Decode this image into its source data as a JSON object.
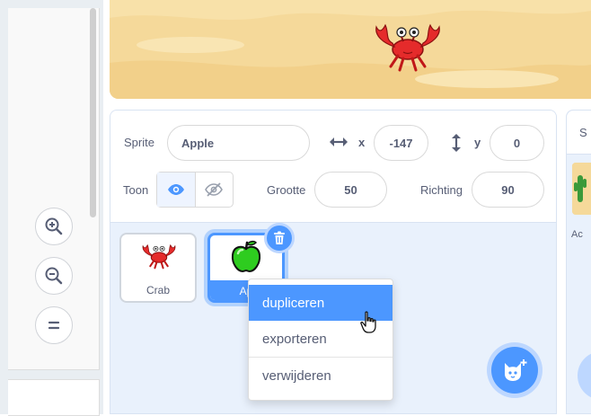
{
  "sprite_info": {
    "sprite_label": "Sprite",
    "sprite_name": "Apple",
    "x_label": "x",
    "x_value": "-147",
    "y_label": "y",
    "y_value": "0",
    "show_label": "Toon",
    "size_label": "Grootte",
    "size_value": "50",
    "direction_label": "Richting",
    "direction_value": "90"
  },
  "sprites": [
    {
      "name": "Crab",
      "selected": false
    },
    {
      "name": "Apple",
      "selected": true,
      "visible_label": "Ap"
    }
  ],
  "context_menu": {
    "items": [
      {
        "label": "dupliceren",
        "highlighted": true
      },
      {
        "label": "exporteren",
        "highlighted": false
      },
      {
        "label": "verwijderen",
        "highlighted": false
      }
    ]
  },
  "stage_pane": {
    "header_fragment": "S",
    "backdrop_fragment": "Ac"
  },
  "colors": {
    "accent": "#4c97ff",
    "pane_bg": "#e9f1fc",
    "stage_sand": "#f5d99a",
    "crab": "#e52b2b",
    "apple": "#2ecc1f"
  },
  "icons": {
    "zoom_in": "zoom-in-icon",
    "zoom_out": "zoom-out-icon",
    "zoom_reset": "zoom-reset-icon",
    "delete": "trash-icon",
    "add_sprite": "cat-plus-icon",
    "cursor": "hand-pointer-icon"
  }
}
